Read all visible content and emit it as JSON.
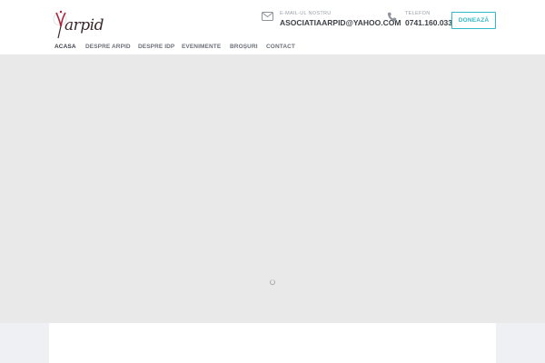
{
  "brand": {
    "logo_text": "arpid",
    "logo_accent": "#a8243d"
  },
  "contact": {
    "email_label": "E-MAIL-UL NOSTRU",
    "email_value": "ASOCIATIAARPID@YAHOO.COM",
    "phone_label": "TELEFON",
    "phone_value": "0741.160.033"
  },
  "donate_label": "DONEAZĂ",
  "nav": {
    "items": [
      {
        "label": "ACASA",
        "active": true
      },
      {
        "label": "DESPRE ARPID"
      },
      {
        "label": "DESPRE IDP"
      },
      {
        "label": "EVENIMENTE"
      },
      {
        "label": "BROȘURI"
      },
      {
        "label": "CONTACT"
      }
    ]
  },
  "colors": {
    "accent": "#33b8c7",
    "hero_bg": "#e9e9e9",
    "text_dark": "#3d4147"
  },
  "icons": {
    "email": "envelope-icon",
    "phone": "phone-icon",
    "loader": "spinner-icon"
  }
}
